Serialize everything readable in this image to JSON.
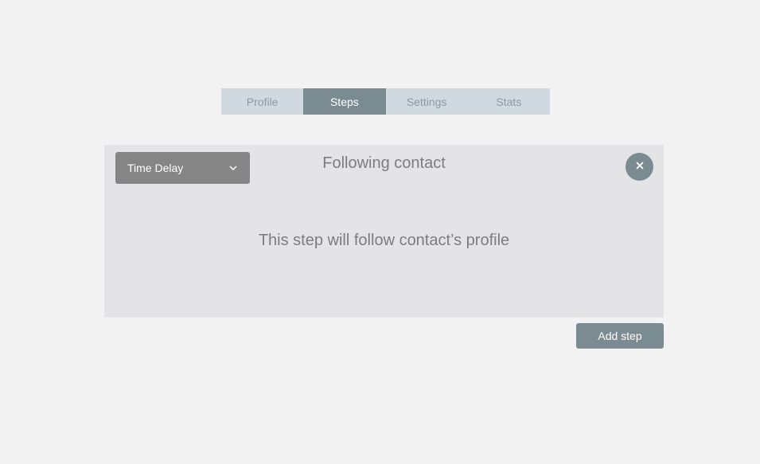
{
  "tabs": [
    {
      "label": "Profile",
      "active": false
    },
    {
      "label": "Steps",
      "active": true
    },
    {
      "label": "Settings",
      "active": false
    },
    {
      "label": "Stats",
      "active": false
    }
  ],
  "step": {
    "type_select": {
      "selected": "Time Delay",
      "icon": "chevron-down-icon"
    },
    "title": "Following contact",
    "message": "This step will follow contact’s profile",
    "close_icon": "close-icon"
  },
  "add_step_label": "Add step",
  "colors": {
    "background": "#f2f2f2",
    "tab_bar": "#d0d9df",
    "tab_active": "#7a8b92",
    "card": "#e4e4e6",
    "select": "#858585",
    "accent": "#7a8b92"
  }
}
